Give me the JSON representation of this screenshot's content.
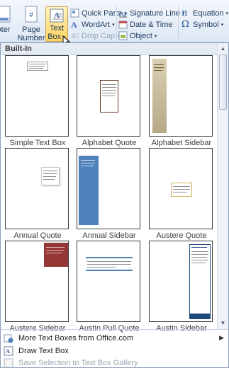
{
  "ribbon": {
    "footer_label": "oter",
    "page_number_label_1": "Page",
    "page_number_label_2": "Number",
    "text_box_label_1": "Text",
    "text_box_label_2": "Box",
    "quick_parts": "Quick Parts",
    "wordart": "WordArt",
    "drop_cap": "Drop Cap",
    "signature_line": "Signature Line",
    "date_time": "Date & Time",
    "object": "Object",
    "equation": "Equation",
    "symbol": "Symbol"
  },
  "gallery": {
    "section_header": "Built-In",
    "tiles": [
      {
        "label": "Simple Text Box"
      },
      {
        "label": "Alphabet Quote"
      },
      {
        "label": "Alphabet Sidebar"
      },
      {
        "label": "Annual Quote"
      },
      {
        "label": "Annual Sidebar"
      },
      {
        "label": "Austere Quote"
      },
      {
        "label": "Austere Sidebar"
      },
      {
        "label": "Austin Pull Quote"
      },
      {
        "label": "Austin Sidebar"
      }
    ]
  },
  "menu": {
    "more_text_boxes": "More Text Boxes from Office.com",
    "draw_text_box": "Draw Text Box",
    "save_selection": "Save Selection to Text Box Gallery"
  },
  "colors": {
    "annual_sidebar_blue": "#4f81bd",
    "austere_sidebar_red": "#943634",
    "alphabet_sidebar_tan": "#c9bf9f",
    "austin_sidebar_blue": "#1f497d"
  }
}
